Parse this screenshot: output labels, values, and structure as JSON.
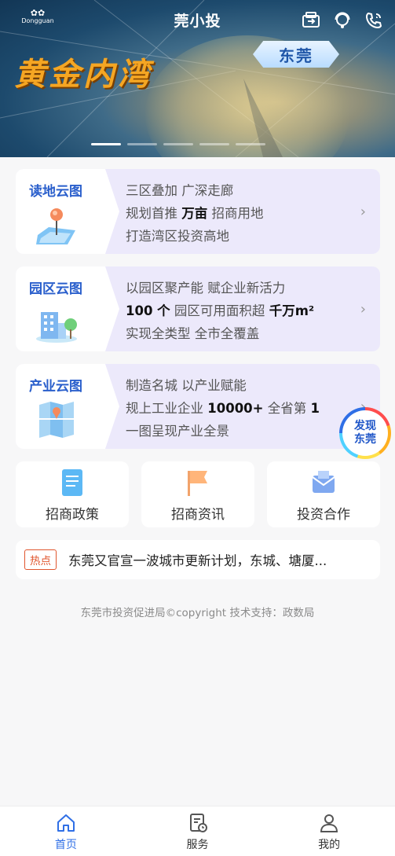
{
  "header": {
    "logo_text": "Dongguan",
    "title": "莞小投",
    "icons": [
      "switch-icon",
      "service-agent-icon",
      "phone-icon"
    ]
  },
  "banner": {
    "headline": "黄金内湾",
    "city_tag": "东莞",
    "slides_total": 5,
    "active_slide": 1
  },
  "cards": [
    {
      "title": "读地云图",
      "icon": "map-pin-icon",
      "line1": "三区叠加 广深走廊",
      "line2_pre": "规划首推 ",
      "line2_bold": "万亩",
      "line2_post": " 招商用地",
      "line3": "打造湾区投资高地"
    },
    {
      "title": "园区云图",
      "icon": "park-buildings-icon",
      "line1": "以园区聚产能 赋企业新活力",
      "line2_bold_a": "100 个",
      "line2_mid": " 园区可用面积超 ",
      "line2_bold_b": "千万m²",
      "line3": "实现全类型 全市全覆盖"
    },
    {
      "title": "产业云图",
      "icon": "folded-map-icon",
      "line1": "制造名城 以产业赋能",
      "line2_pre": "规上工业企业 ",
      "line2_bold_a": "10000+",
      "line2_mid": " 全省第 ",
      "line2_bold_b": "1",
      "line3": "一图呈现产业全景"
    }
  ],
  "fab": {
    "line1": "发现",
    "line2": "东莞"
  },
  "tiles": [
    {
      "label": "招商政策",
      "icon": "document-icon"
    },
    {
      "label": "招商资讯",
      "icon": "flag-icon"
    },
    {
      "label": "投资合作",
      "icon": "mail-icon"
    }
  ],
  "hot": {
    "tag": "热点",
    "text": "东莞又官宣一波城市更新计划，东城、塘厦..."
  },
  "footer_note": "东莞市投资促进局©copyright 技术支持：政数局",
  "tabbar": [
    {
      "label": "首页",
      "icon": "home-icon",
      "active": true
    },
    {
      "label": "服务",
      "icon": "service-clock-icon",
      "active": false
    },
    {
      "label": "我的",
      "icon": "user-icon",
      "active": false
    }
  ],
  "colors": {
    "accent": "#2f6fe6",
    "card_bg": "#ece9fb",
    "hot_tag": "#e0562e",
    "headline": "#f5a623"
  }
}
